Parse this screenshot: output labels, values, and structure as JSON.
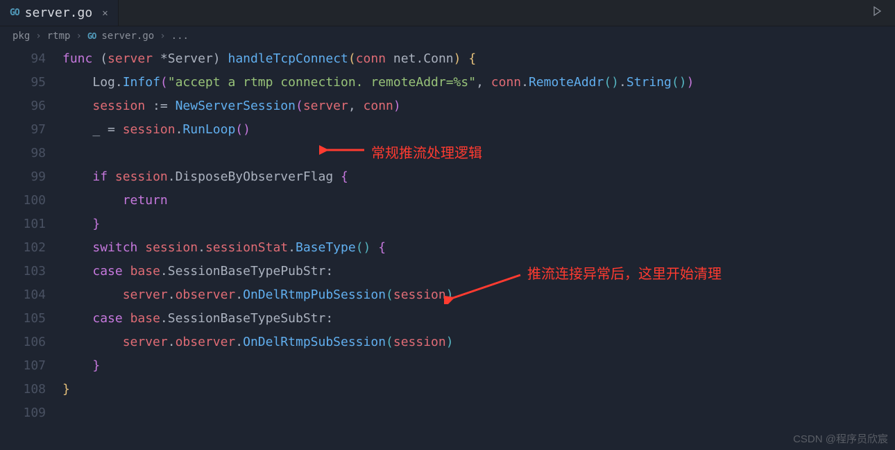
{
  "tab": {
    "filename": "server.go"
  },
  "breadcrumbs": {
    "pkg": "pkg",
    "rtmp": "rtmp",
    "file": "server.go",
    "more": "..."
  },
  "lines": {
    "start": 94,
    "end": 109
  },
  "code": {
    "l94": {
      "kw": "func",
      "recv_open": " (",
      "recv_name": "server",
      "recv_star": " *",
      "recv_type": "Server",
      "recv_close": ") ",
      "fn": "handleTcpConnect",
      "args_open": "(",
      "arg_name": "conn",
      "arg_sp": " ",
      "arg_pkg": "net",
      "arg_dot": ".",
      "arg_type": "Conn",
      "args_close": ") ",
      "brace": "{"
    },
    "l95": {
      "indent": "    ",
      "obj": "Log",
      "dot": ".",
      "fn": "Infof",
      "open": "(",
      "str": "\"accept a rtmp connection. remoteAddr=%s\"",
      "comma": ", ",
      "obj2": "conn",
      "dot2": ".",
      "fn2": "RemoteAddr",
      "call2": "()",
      "dot3": ".",
      "fn3": "String",
      "call3": "()",
      "close": ")"
    },
    "l96": {
      "indent": "    ",
      "var": "session",
      "op": " := ",
      "fn": "NewServerSession",
      "open": "(",
      "a1": "server",
      "comma": ", ",
      "a2": "conn",
      "close": ")"
    },
    "l97": {
      "indent": "    ",
      "blank": "_",
      "eq": " = ",
      "obj": "session",
      "dot": ".",
      "fn": "RunLoop",
      "call": "()"
    },
    "l98": {
      "empty": ""
    },
    "l99": {
      "indent": "    ",
      "kw": "if",
      "sp": " ",
      "obj": "session",
      "dot": ".",
      "prop": "DisposeByObserverFlag",
      "sp2": " ",
      "brace": "{"
    },
    "l100": {
      "indent": "        ",
      "kw": "return"
    },
    "l101": {
      "indent": "    ",
      "brace": "}"
    },
    "l102": {
      "indent": "    ",
      "kw": "switch",
      "sp": " ",
      "obj": "session",
      "dot": ".",
      "prop": "sessionStat",
      "dot2": ".",
      "fn": "BaseType",
      "call": "()",
      "sp2": " ",
      "brace": "{"
    },
    "l103": {
      "indent": "    ",
      "kw": "case",
      "sp": " ",
      "obj": "base",
      "dot": ".",
      "prop": "SessionBaseTypePubStr",
      "colon": ":"
    },
    "l104": {
      "indent": "        ",
      "obj": "server",
      "dot": ".",
      "prop": "observer",
      "dot2": ".",
      "fn": "OnDelRtmpPubSession",
      "open": "(",
      "arg": "session",
      "close": ")"
    },
    "l105": {
      "indent": "    ",
      "kw": "case",
      "sp": " ",
      "obj": "base",
      "dot": ".",
      "prop": "SessionBaseTypeSubStr",
      "colon": ":"
    },
    "l106": {
      "indent": "        ",
      "obj": "server",
      "dot": ".",
      "prop": "observer",
      "dot2": ".",
      "fn": "OnDelRtmpSubSession",
      "open": "(",
      "arg": "session",
      "close": ")"
    },
    "l107": {
      "indent": "    ",
      "brace": "}"
    },
    "l108": {
      "brace": "}"
    },
    "l109": {
      "empty": ""
    }
  },
  "annotations": {
    "a1": "常规推流处理逻辑",
    "a2": "推流连接异常后，这里开始清理"
  },
  "watermark": "CSDN @程序员欣宸"
}
